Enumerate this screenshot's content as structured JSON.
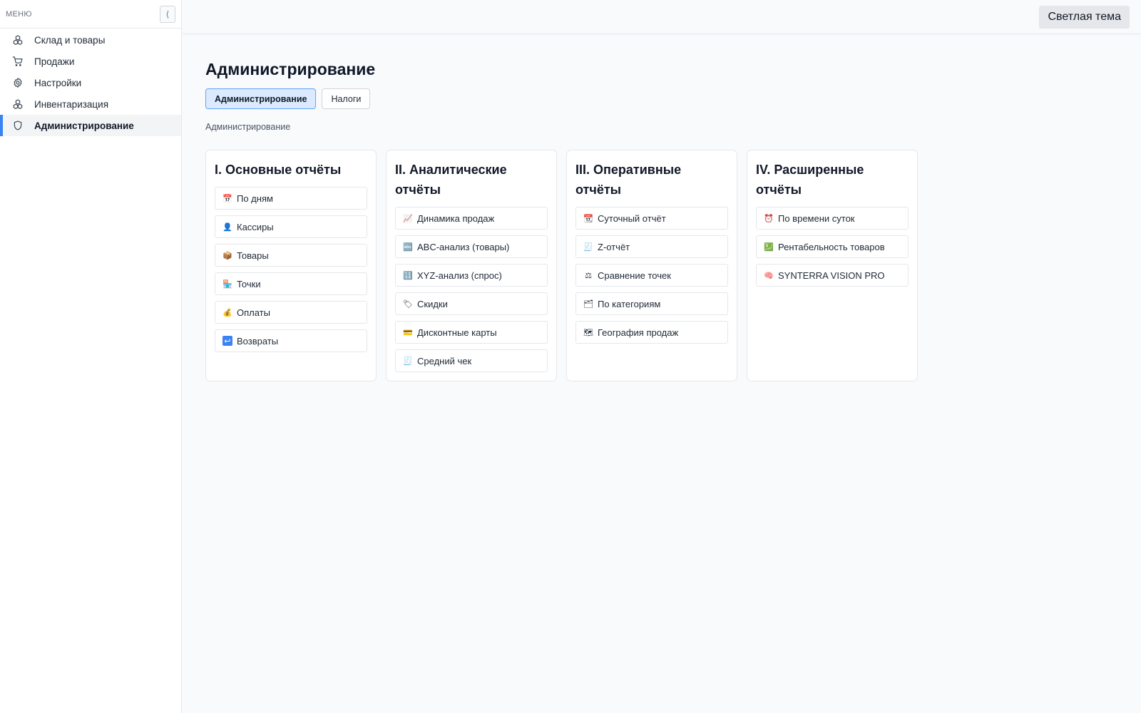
{
  "sidebar": {
    "title": "МЕНЮ",
    "collapse_glyph": "⟨",
    "items": [
      {
        "label": "Склад и товары",
        "icon": "cubes-icon"
      },
      {
        "label": "Продажи",
        "icon": "cart-icon"
      },
      {
        "label": "Настройки",
        "icon": "gear-icon"
      },
      {
        "label": "Инвентаризация",
        "icon": "cubes-icon"
      },
      {
        "label": "Администрирование",
        "icon": "shield-icon",
        "active": true
      }
    ],
    "accent_color": "#3b82f6"
  },
  "topbar": {
    "theme_button": "Светлая тема"
  },
  "main": {
    "title": "Администрирование",
    "tabs": [
      {
        "label": "Администрирование",
        "active": true
      },
      {
        "label": "Налоги",
        "active": false
      }
    ],
    "breadcrumb": "Администрирование",
    "cards": [
      {
        "title": "I. Основные отчёты",
        "items": [
          {
            "label": "По дням",
            "emoji": "📅"
          },
          {
            "label": "Кассиры",
            "emoji": "👤"
          },
          {
            "label": "Товары",
            "emoji": "📦"
          },
          {
            "label": "Точки",
            "emoji": "🏪"
          },
          {
            "label": "Оплаты",
            "emoji": "💰"
          },
          {
            "label": "Возвраты",
            "emoji": "↩"
          }
        ]
      },
      {
        "title": "II. Аналитические отчёты",
        "items": [
          {
            "label": "Динамика продаж",
            "emoji": "📈"
          },
          {
            "label": "ABC-анализ (товары)",
            "emoji": "🔤"
          },
          {
            "label": "XYZ-анализ (спрос)",
            "emoji": "🔢"
          },
          {
            "label": "Скидки",
            "emoji": "🏷"
          },
          {
            "label": "Дисконтные карты",
            "emoji": "💳"
          },
          {
            "label": "Средний чек",
            "emoji": "🧾"
          }
        ]
      },
      {
        "title": "III. Оперативные отчёты",
        "items": [
          {
            "label": "Суточный отчёт",
            "emoji": "📆"
          },
          {
            "label": "Z-отчёт",
            "emoji": "🧾"
          },
          {
            "label": "Сравнение точек",
            "emoji": "⚖"
          },
          {
            "label": "По категориям",
            "emoji": "🗂"
          },
          {
            "label": "География продаж",
            "emoji": "🗺"
          }
        ]
      },
      {
        "title": "IV. Расширенные отчёты",
        "items": [
          {
            "label": "По времени суток",
            "emoji": "⏰"
          },
          {
            "label": "Рентабельность товаров",
            "emoji": "💹"
          },
          {
            "label": "SYNTERRA VISION PRO",
            "emoji": "🧠"
          }
        ]
      }
    ]
  }
}
